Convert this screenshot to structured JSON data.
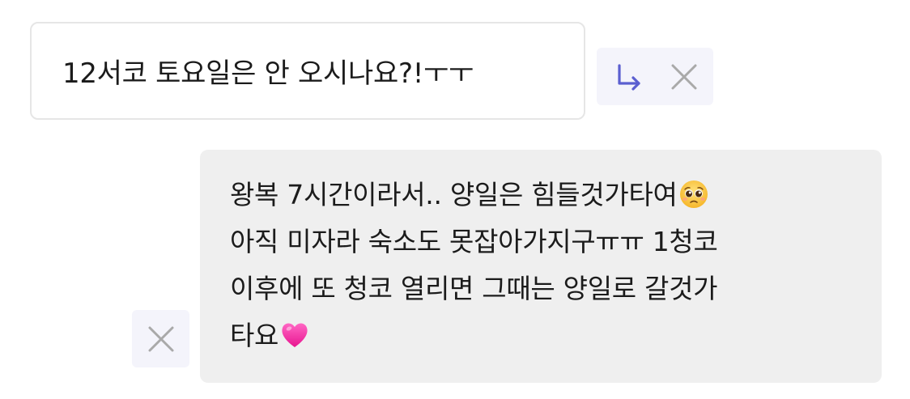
{
  "incoming_message": {
    "text": "12서코 토요일은 안 오시나요?!ㅜㅜ"
  },
  "outgoing_message": {
    "lines": [
      "왕복 7시간이라서.. 양일은 힘들것가타여",
      "아직 미자라 숙소도 못잡아가지구ㅠㅠ 1청코",
      "이후에 또 청코 열리면 그때는 양일로 갈것가",
      "타요"
    ],
    "line1_emoji": "pleading-face-emoji",
    "line4_emoji": "pink-heart-emoji"
  },
  "icons": {
    "reply": "reply-arrow-icon",
    "close": "close-icon"
  },
  "colors": {
    "reply_icon": "#5b5fd0",
    "close_icon": "#a9a9a9",
    "action_bg": "#f4f4fb",
    "outgoing_bg": "#efefef",
    "incoming_border": "#e6e6e6",
    "heart": "#ff3aa6"
  }
}
